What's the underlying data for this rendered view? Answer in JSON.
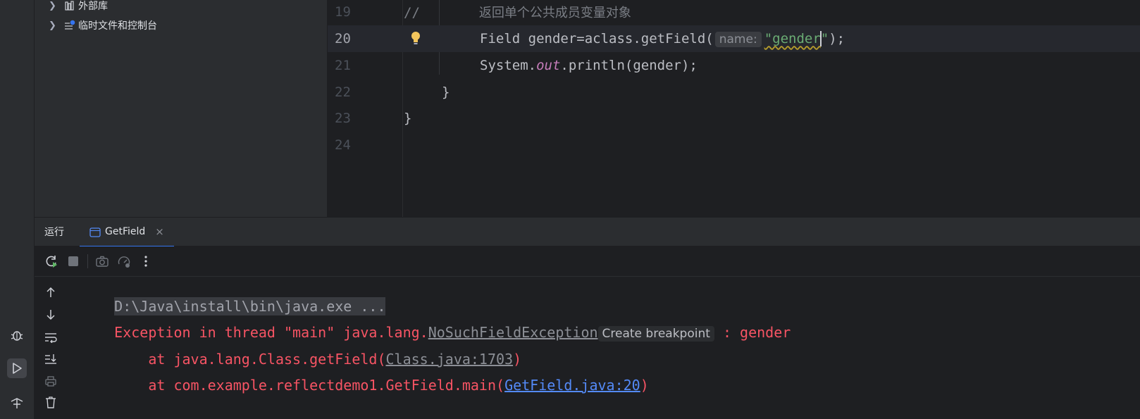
{
  "tree": {
    "items": [
      {
        "label": "外部库",
        "icon": "library-icon"
      },
      {
        "label": "临时文件和控制台",
        "icon": "scratch-icon"
      }
    ]
  },
  "editor": {
    "lines": [
      {
        "num": "19",
        "comment": "//",
        "comment_text": "返回单个公共成员变量对象"
      },
      {
        "num": "20",
        "pre": "Field gender=aclass.getField(",
        "hint": "name:",
        "str_open": "\"gender",
        "str_close": "\"",
        "post": ");"
      },
      {
        "num": "21",
        "pre": "System.",
        "field": "out",
        "post": ".println(gender);"
      },
      {
        "num": "22",
        "code": "}"
      },
      {
        "num": "23",
        "code": "}"
      },
      {
        "num": "24",
        "code": ""
      }
    ]
  },
  "run": {
    "title": "运行",
    "tab_label": "GetField",
    "tab_close": "×"
  },
  "console": {
    "cmd": "D:\\Java\\install\\bin\\java.exe ...",
    "exc_prefix": "Exception in thread \"main\" java.lang.",
    "exc_class": "NoSuchFieldException",
    "breakpoint_label": "Create breakpoint",
    "exc_suffix": " : gender",
    "trace1_prefix": "    at java.lang.Class.getField(",
    "trace1_link": "Class.java:1703",
    "trace1_suffix": ")",
    "trace2_prefix": "    at com.example.reflectdemo1.GetField.main(",
    "trace2_link": "GetField.java:20",
    "trace2_suffix": ")"
  },
  "colors": {
    "background": "#1e1f22",
    "panel": "#2b2d30",
    "error": "#f75464",
    "string": "#6aab73",
    "link": "#548af7",
    "accent": "#3574f0"
  }
}
